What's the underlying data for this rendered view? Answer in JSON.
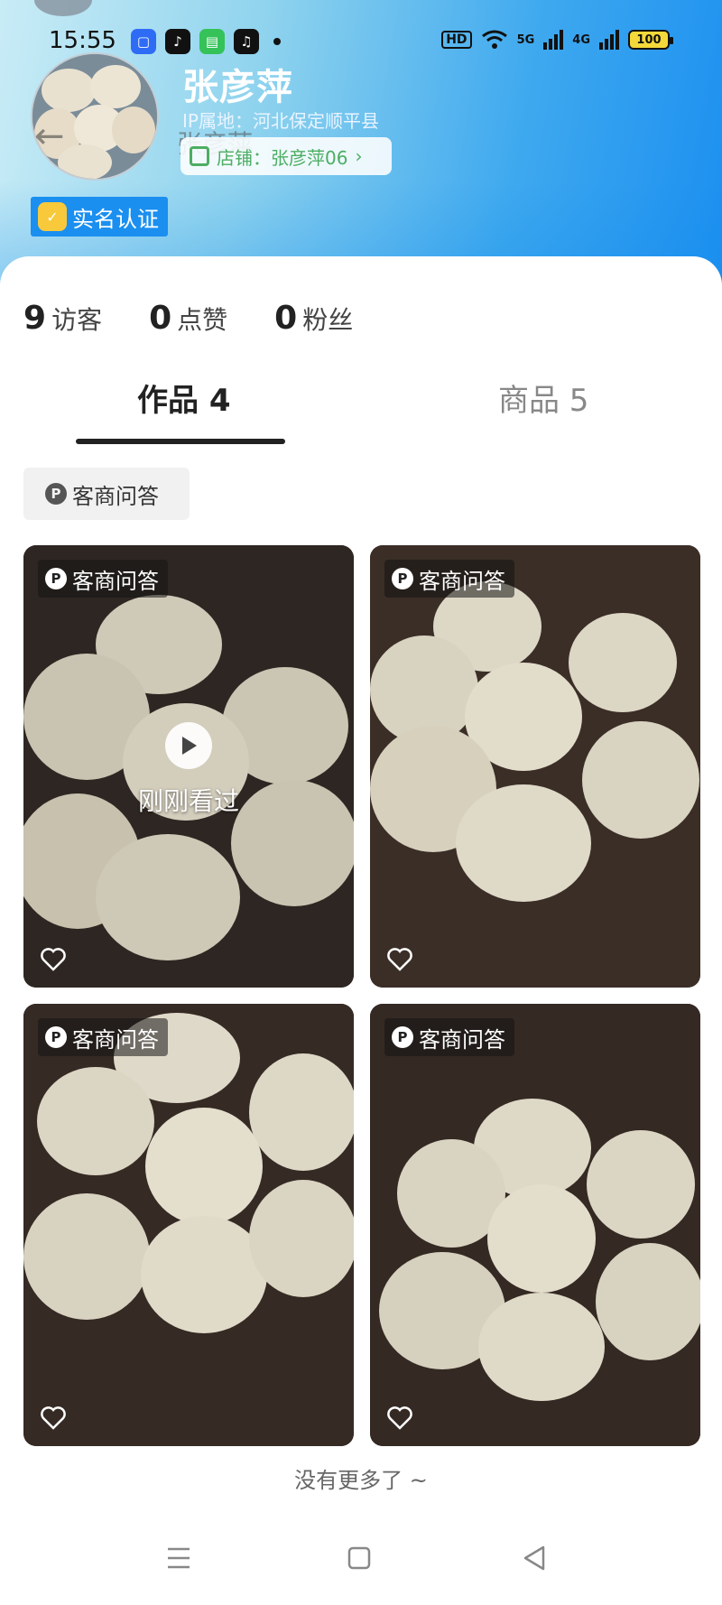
{
  "status_bar": {
    "time": "15:55",
    "apps": [
      {
        "name": "app-blue",
        "color": "#2f6cf6"
      },
      {
        "name": "douyin",
        "color": "#111111"
      },
      {
        "name": "wechat-green",
        "color": "#34c259"
      },
      {
        "name": "douyin-lite",
        "color": "#111111"
      }
    ],
    "hd": "HD",
    "net1": "5G",
    "net2": "4G",
    "battery": "100"
  },
  "profile": {
    "name": "张彦萍",
    "overlay_name": "张彦萍",
    "ip_location": "IP属地：河北保定顺平县",
    "shop": "店铺：张彦萍06",
    "verify": "实名认证"
  },
  "stats": [
    {
      "value": "9",
      "label": "访客"
    },
    {
      "value": "0",
      "label": "点赞"
    },
    {
      "value": "0",
      "label": "粉丝"
    }
  ],
  "tabs": {
    "works": "作品 4",
    "goods": "商品 5"
  },
  "filter_chip": "客商问答",
  "posts": [
    {
      "tag": "客商问答",
      "recent": "刚刚看过"
    },
    {
      "tag": "客商问答"
    },
    {
      "tag": "客商问答"
    },
    {
      "tag": "客商问答"
    }
  ],
  "footer": "没有更多了 ~",
  "colors": {
    "accent_blue": "#1a8ff0",
    "shop_green": "#4cae63",
    "tile_bg": "#3a2d26"
  }
}
